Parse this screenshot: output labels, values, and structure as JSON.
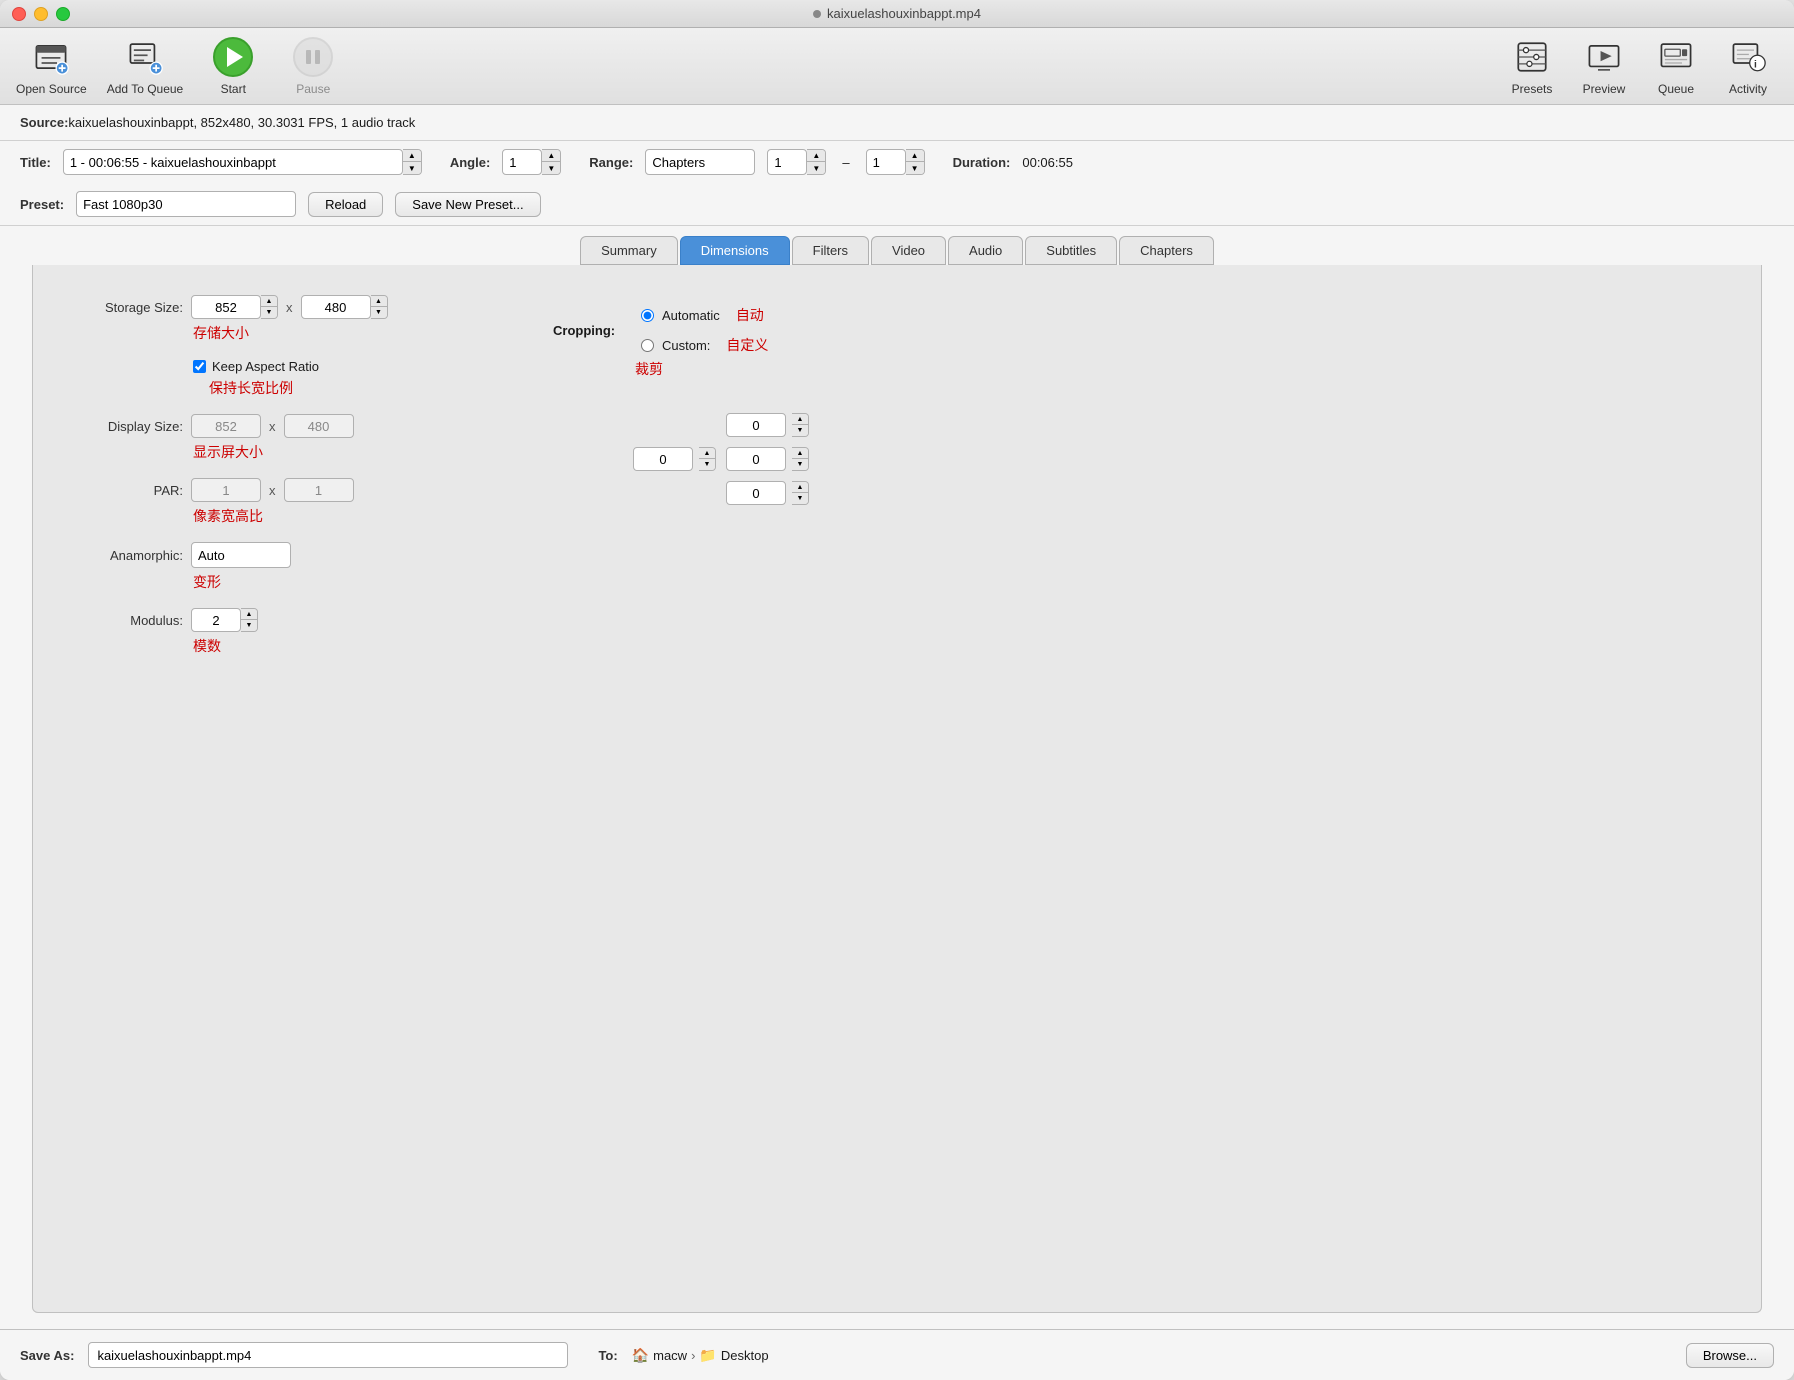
{
  "window": {
    "title": "kaixuelashouxinbappt.mp4"
  },
  "toolbar": {
    "open_source_label": "Open Source",
    "add_to_queue_label": "Add To Queue",
    "start_label": "Start",
    "pause_label": "Pause",
    "presets_label": "Presets",
    "preview_label": "Preview",
    "queue_label": "Queue",
    "activity_label": "Activity"
  },
  "source": {
    "label": "Source:",
    "value": "kaixuelashouxinbappt, 852x480, 30.3031 FPS, 1 audio track"
  },
  "title_row": {
    "title_label": "Title:",
    "title_value": "1 - 00:06:55 - kaixuelashouxinbappt",
    "angle_label": "Angle:",
    "angle_value": "1",
    "range_label": "Range:",
    "range_value": "Chapters",
    "range_start": "1",
    "range_end": "1",
    "duration_label": "Duration:",
    "duration_value": "00:06:55",
    "dash": "–"
  },
  "preset_row": {
    "label": "Preset:",
    "value": "Fast 1080p30",
    "reload_label": "Reload",
    "save_new_label": "Save New Preset..."
  },
  "tabs": {
    "items": [
      {
        "id": "summary",
        "label": "Summary",
        "active": false
      },
      {
        "id": "dimensions",
        "label": "Dimensions",
        "active": true
      },
      {
        "id": "filters",
        "label": "Filters",
        "active": false
      },
      {
        "id": "video",
        "label": "Video",
        "active": false
      },
      {
        "id": "audio",
        "label": "Audio",
        "active": false
      },
      {
        "id": "subtitles",
        "label": "Subtitles",
        "active": false
      },
      {
        "id": "chapters",
        "label": "Chapters",
        "active": false
      }
    ]
  },
  "dimensions": {
    "storage_size_label": "Storage Size:",
    "storage_annotation": "存储大小",
    "width": "852",
    "height": "480",
    "keep_aspect_label": "Keep Aspect Ratio",
    "keep_aspect_annotation": "保持长宽比例",
    "display_size_label": "Display Size:",
    "display_annotation": "显示屏大小",
    "display_width": "852",
    "display_height": "480",
    "par_label": "PAR:",
    "par_annotation": "像素宽高比",
    "par_w": "1",
    "par_h": "1",
    "anamorphic_label": "Anamorphic:",
    "anamorphic_annotation": "变形",
    "anamorphic_value": "Auto",
    "modulus_label": "Modulus:",
    "modulus_annotation": "模数",
    "modulus_value": "2",
    "cropping_label": "Cropping:",
    "cropping_annotation": "裁剪",
    "automatic_label": "Automatic",
    "automatic_annotation": "自动",
    "custom_label": "Custom:",
    "custom_annotation": "自定义",
    "crop_top": "0",
    "crop_right": "0",
    "crop_bottom": "0",
    "crop_left": "0",
    "x_sep": "x"
  },
  "save_row": {
    "label": "Save As:",
    "value": "kaixuelashouxinbappt.mp4",
    "to_label": "To:",
    "home_icon": "🏠",
    "user": "macw",
    "sep": "›",
    "folder_icon": "📁",
    "folder": "Desktop",
    "browse_label": "Browse..."
  }
}
